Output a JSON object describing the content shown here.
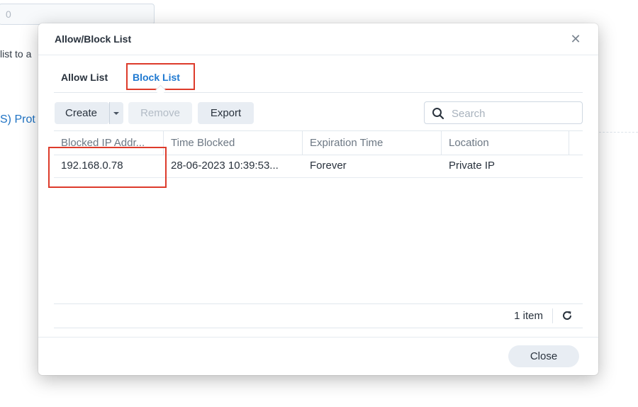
{
  "background": {
    "field_value": "0",
    "text_fragment": "list to a",
    "link_fragment": "S) Prot"
  },
  "dialog": {
    "title": "Allow/Block List",
    "close_glyph": "✕",
    "tabs": [
      {
        "label": "Allow List",
        "active": false
      },
      {
        "label": "Block List",
        "active": true
      }
    ],
    "toolbar": {
      "create_label": "Create",
      "remove_label": "Remove",
      "export_label": "Export",
      "search_placeholder": "Search"
    },
    "table": {
      "columns": [
        "Blocked IP Addr...",
        "Time Blocked",
        "Expiration Time",
        "Location"
      ],
      "rows": [
        [
          "192.168.0.78",
          "28-06-2023 10:39:53...",
          "Forever",
          "Private IP"
        ]
      ]
    },
    "footer": {
      "count_text": "1 item",
      "close_label": "Close"
    }
  },
  "colors": {
    "active_tab": "#1f79d1",
    "highlight_box": "#dd3b2b",
    "link": "#1e72c3"
  },
  "icons": [
    "search-icon",
    "refresh-icon",
    "chevron-down-icon",
    "close-icon"
  ]
}
